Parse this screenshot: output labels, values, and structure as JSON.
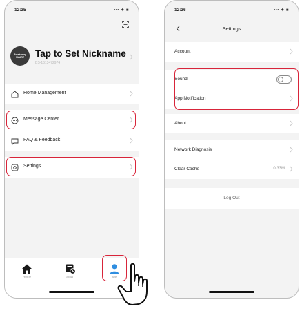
{
  "left_screen": {
    "status_time": "12:35",
    "status_indicators": "••• ✦ ■",
    "avatar_text": "Breakaway SMART",
    "nickname": "Tap to Set Nickname",
    "user_id": "BS-1613472974",
    "menu_group1": [
      {
        "label": "Home Management",
        "icon": "home-outline-icon"
      }
    ],
    "menu_group2": [
      {
        "label": "Message Center",
        "icon": "chat-bubble-icon"
      },
      {
        "label": "FAQ & Feedback",
        "icon": "feedback-icon"
      }
    ],
    "menu_group3": [
      {
        "label": "Settings",
        "icon": "settings-icon"
      }
    ],
    "tabs": [
      {
        "label": "Home",
        "icon": "home-icon"
      },
      {
        "label": "Smart",
        "icon": "smart-icon"
      },
      {
        "label": "Me",
        "icon": "person-icon"
      }
    ]
  },
  "right_screen": {
    "status_time": "12:36",
    "status_indicators": "••• ✦ ■",
    "title": "Settings",
    "group1": [
      {
        "label": "Account"
      }
    ],
    "group2": [
      {
        "label": "Sound",
        "control": "toggle",
        "enabled": false
      },
      {
        "label": "App Notification"
      }
    ],
    "group3": [
      {
        "label": "About"
      }
    ],
    "group4": [
      {
        "label": "Network Diagnosis"
      },
      {
        "label": "Clear Cache",
        "value": "0.33M"
      }
    ],
    "logout_label": "Log Out"
  },
  "colors": {
    "highlight": "#d8253a",
    "accent_blue": "#2f8ee0",
    "background": "#f3f3f3"
  }
}
